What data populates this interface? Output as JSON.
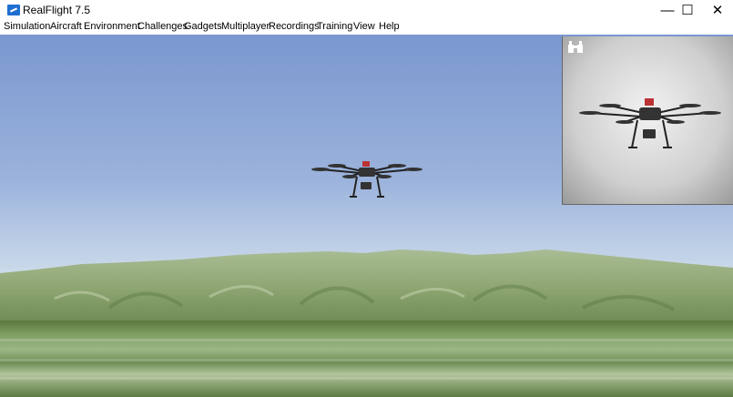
{
  "window": {
    "title": "RealFlight 7.5",
    "minimize_glyph": "—",
    "maximize_glyph": "☐",
    "close_glyph": "✕"
  },
  "menu": {
    "items": [
      {
        "label": "Simulation"
      },
      {
        "label": "Aircraft"
      },
      {
        "label": "Environment"
      },
      {
        "label": "Challenges"
      },
      {
        "label": "Gadgets"
      },
      {
        "label": "Multiplayer"
      },
      {
        "label": "Recordings"
      },
      {
        "label": "Training"
      },
      {
        "label": "View"
      },
      {
        "label": "Help"
      }
    ]
  },
  "scene": {
    "main_object": "hexacopter-drone",
    "pip_object": "hexacopter-drone",
    "pip_icon": "binoculars-icon"
  },
  "colors": {
    "sky_top": "#7a97cf",
    "sky_horizon": "#d6e1ea",
    "hills": "#8fa773",
    "ground": "#6f8d55",
    "app_icon": "#1e6fd0"
  }
}
